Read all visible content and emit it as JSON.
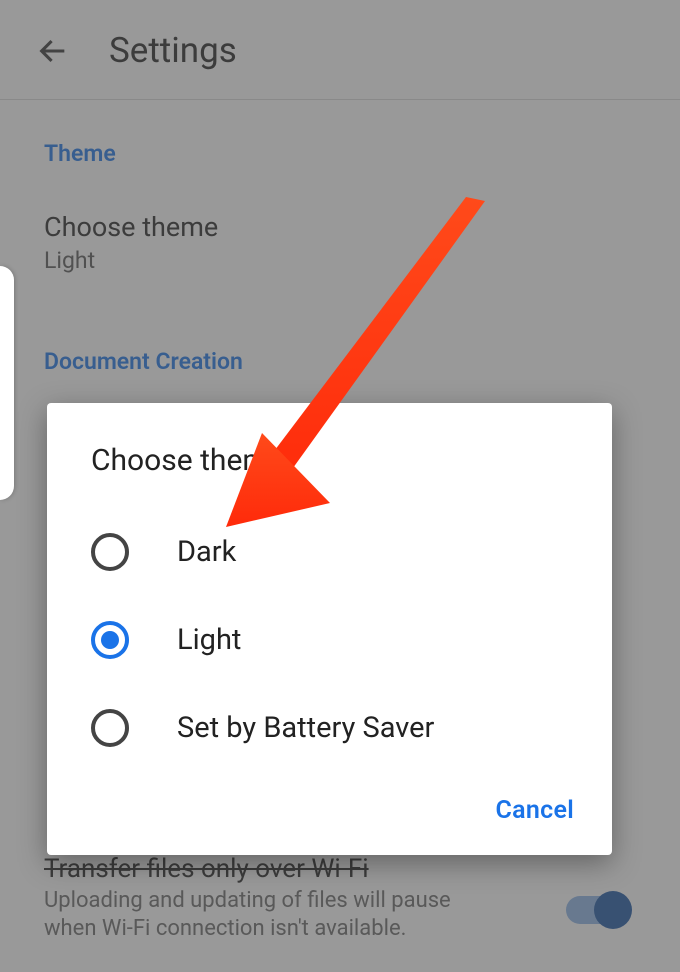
{
  "header": {
    "title": "Settings"
  },
  "sections": {
    "theme": {
      "title": "Theme",
      "setting_label": "Choose theme",
      "setting_value": "Light"
    },
    "doc_creation": {
      "title": "Document Creation"
    },
    "wifi": {
      "title": "Transfer files only over Wi-Fi",
      "description": "Uploading and updating of files will pause when Wi-Fi connection isn't available.",
      "toggle_on": true
    }
  },
  "dialog": {
    "title": "Choose theme",
    "options": [
      {
        "label": "Dark",
        "selected": false
      },
      {
        "label": "Light",
        "selected": true
      },
      {
        "label": "Set by Battery Saver",
        "selected": false
      }
    ],
    "cancel_label": "Cancel"
  },
  "annotation": {
    "arrow_color": "#ff3a1a"
  }
}
